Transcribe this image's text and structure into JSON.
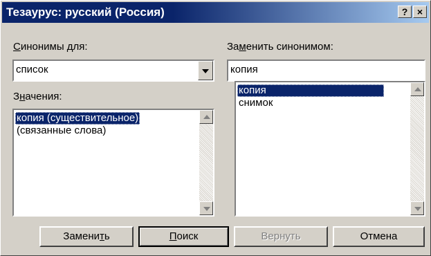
{
  "window": {
    "title": "Тезаурус: русский (Россия)",
    "help_button": "?",
    "close_button": "×"
  },
  "synonyms_for": {
    "label_prefix": "",
    "label_accel": "С",
    "label_rest": "инонимы для:",
    "value": "список"
  },
  "meanings": {
    "label_prefix": "З",
    "label_accel": "н",
    "label_rest": "ачения:",
    "items": [
      "копия (существительное)",
      "(связанные слова)"
    ],
    "selected_index": 0
  },
  "replace_with": {
    "label_prefix": "За",
    "label_accel": "м",
    "label_rest": "енить синонимом:",
    "value": "копия",
    "items": [
      "копия",
      "снимок"
    ],
    "selected_index": 0
  },
  "buttons": {
    "replace": {
      "prefix": "Замени",
      "accel": "т",
      "rest": "ь"
    },
    "search": {
      "prefix": "",
      "accel": "П",
      "rest": "оиск"
    },
    "back": {
      "label": "Вернуть"
    },
    "cancel": {
      "label": "Отмена"
    }
  },
  "colors": {
    "dialog_face": "#d4d0c8",
    "title_start": "#0a246a",
    "title_end": "#a6caf0",
    "selection": "#0a246a"
  }
}
